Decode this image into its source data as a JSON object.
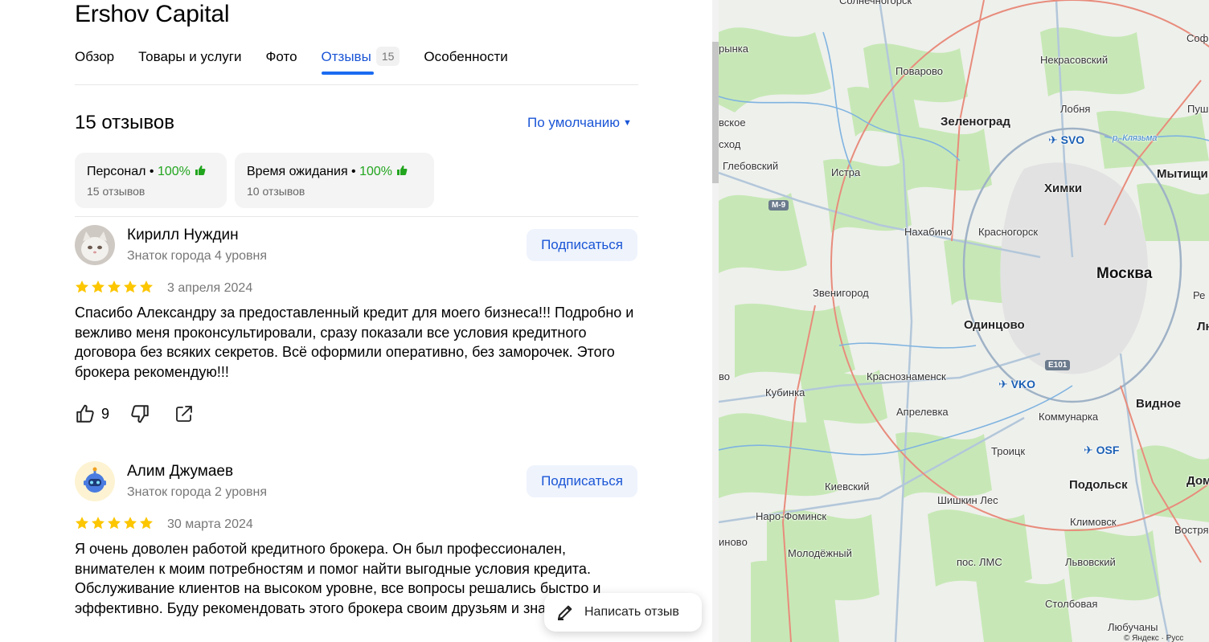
{
  "business": {
    "title": "Ershov Capital"
  },
  "tabs": [
    {
      "label": "Обзор"
    },
    {
      "label": "Товары и услуги"
    },
    {
      "label": "Фото"
    },
    {
      "label": "Отзывы",
      "count": "15",
      "active": true
    },
    {
      "label": "Особенности"
    }
  ],
  "reviews_header": {
    "count_label": "15 отзывов",
    "sort_label": "По умолчанию"
  },
  "aspects": [
    {
      "name": "Персонал",
      "percent": "100%",
      "count": "15 отзывов"
    },
    {
      "name": "Время ожидания",
      "percent": "100%",
      "count": "10 отзывов"
    }
  ],
  "reviews": [
    {
      "author": "Кирилл Нуждин",
      "level": "Знаток города 4 уровня",
      "subscribe_label": "Подписаться",
      "rating": 5,
      "date": "3 апреля 2024",
      "text": "Спасибо Александру за предоставленный кредит для моего бизнеса!!! Подробно и вежливо меня проконсультировали, сразу показали все условия кредитного договора без всяких секретов. Всё оформили оперативно, без заморочек. Этого брокера рекомендую!!!",
      "likes": "9"
    },
    {
      "author": "Алим Джумаев",
      "level": "Знаток города 2 уровня",
      "subscribe_label": "Подписаться",
      "rating": 5,
      "date": "30 марта 2024",
      "text": "Я очень доволен работой кредитного брокера. Он был профессионален, внимателен к моим потребностям и помог найти выгодные условия кредита. Обслуживание клиентов на высоком уровне, все вопросы решались быстро и эффективно. Буду рекомендовать этого брокера своим друзьям и знакомым"
    }
  ],
  "write_review": {
    "label": "Написать отзыв"
  },
  "colors": {
    "accent": "#1a55d6",
    "positive": "#22a51e",
    "star": "#fcc600"
  },
  "map": {
    "labels": [
      "Солнечногорск",
      "Софр",
      "рынка",
      "Некрасовский",
      "Поварово",
      "Лобня",
      "Пуш",
      "вское",
      "Зеленоград",
      "SVO",
      "р. Клязьма",
      "сход",
      "Глебовский",
      "Истра",
      "Химки",
      "Мытищи",
      "М-9",
      "Нахабино",
      "Красногорск",
      "Москва",
      "Ре",
      "Звенигород",
      "Одинцово",
      "Лю",
      "E101",
      "во",
      "Краснознаменск",
      "VKO",
      "Кубинка",
      "Видное",
      "Апрелевка",
      "Коммунарка",
      "OSF",
      "Троицк",
      "Киевский",
      "Подольск",
      "Дом",
      "Шишкин Лес",
      "Наро-Фоминск",
      "Климовск",
      "Востряк",
      "инoвo",
      "Молодёжный",
      "пос. ЛМС",
      "Львовский",
      "Столбовая",
      "Любучаны"
    ],
    "copyright": "© Яндекс · Русс"
  }
}
